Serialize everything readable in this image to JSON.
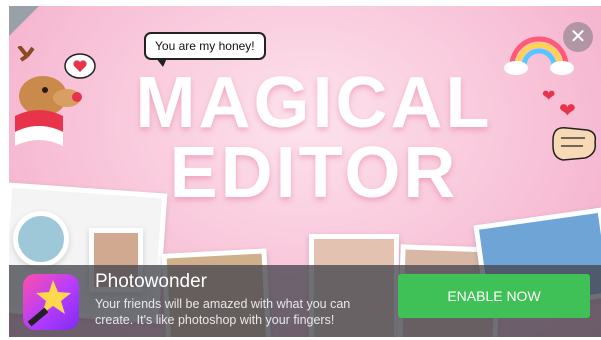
{
  "ad": {
    "badge": "AD",
    "close_icon": "close-icon",
    "bubble_text": "You are my honey!",
    "headline": {
      "line1": "MAGICAL",
      "line2": "EDITOR"
    },
    "app": {
      "name": "Photowonder",
      "description": "Your friends will be amazed with what you can create. It's like photoshop with your fingers!",
      "icon": "photowonder-wand-icon"
    },
    "cta_label": "ENABLE NOW",
    "colors": {
      "background": "#f8c3d8",
      "cta": "#3fc157",
      "bar": "#46464f"
    }
  }
}
